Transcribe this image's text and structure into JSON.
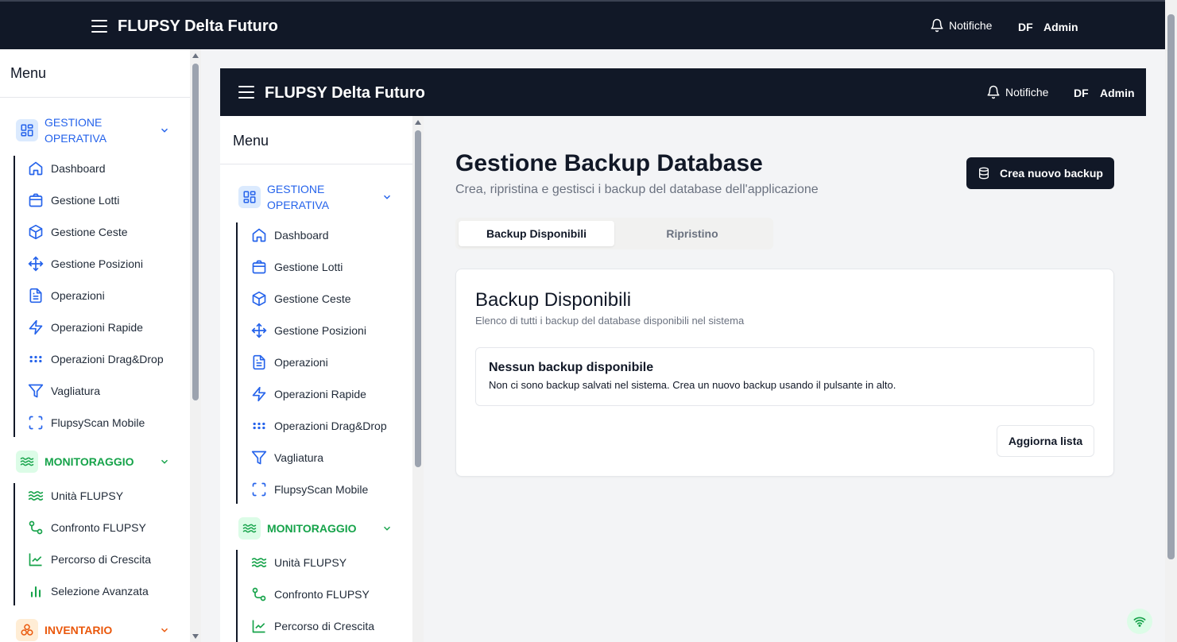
{
  "app": {
    "brand": "FLUPSY Delta Futuro",
    "notifications_label": "Notifiche",
    "user_initials": "DF",
    "user_name": "Admin"
  },
  "sidebar": {
    "title": "Menu",
    "groups": [
      {
        "label": "GESTIONE OPERATIVA",
        "color": "#2563eb",
        "items": [
          {
            "label": "Dashboard",
            "icon": "home-icon"
          },
          {
            "label": "Gestione Lotti",
            "icon": "package-icon"
          },
          {
            "label": "Gestione Ceste",
            "icon": "box-icon"
          },
          {
            "label": "Gestione Posizioni",
            "icon": "move-icon"
          },
          {
            "label": "Operazioni",
            "icon": "file-text-icon"
          },
          {
            "label": "Operazioni Rapide",
            "icon": "zap-icon"
          },
          {
            "label": "Operazioni Drag&Drop",
            "icon": "grip-icon"
          },
          {
            "label": "Vagliatura",
            "icon": "filter-icon"
          },
          {
            "label": "FlupsyScan Mobile",
            "icon": "scan-icon"
          }
        ]
      },
      {
        "label": "MONITORAGGIO",
        "color": "#16a34a",
        "items": [
          {
            "label": "Unità FLUPSY",
            "icon": "waves-icon"
          },
          {
            "label": "Confronto FLUPSY",
            "icon": "git-compare-icon"
          },
          {
            "label": "Percorso di Crescita",
            "icon": "line-chart-icon"
          },
          {
            "label": "Selezione Avanzata",
            "icon": "bar-chart-icon"
          }
        ]
      },
      {
        "label": "INVENTARIO",
        "color": "#ea580c",
        "items": []
      }
    ]
  },
  "main": {
    "title": "Gestione Backup Database",
    "subtitle": "Crea, ripristina e gestisci i backup del database dell'applicazione",
    "create_button": "Crea nuovo backup",
    "tabs": [
      {
        "label": "Backup Disponibili",
        "active": true
      },
      {
        "label": "Ripristino",
        "active": false
      }
    ],
    "card": {
      "title": "Backup Disponibili",
      "subtitle": "Elenco di tutti i backup del database disponibili nel sistema",
      "empty_title": "Nessun backup disponibile",
      "empty_text": "Non ci sono backup salvati nel sistema. Crea un nuovo backup usando il pulsante in alto.",
      "refresh_button": "Aggiorna lista"
    }
  }
}
